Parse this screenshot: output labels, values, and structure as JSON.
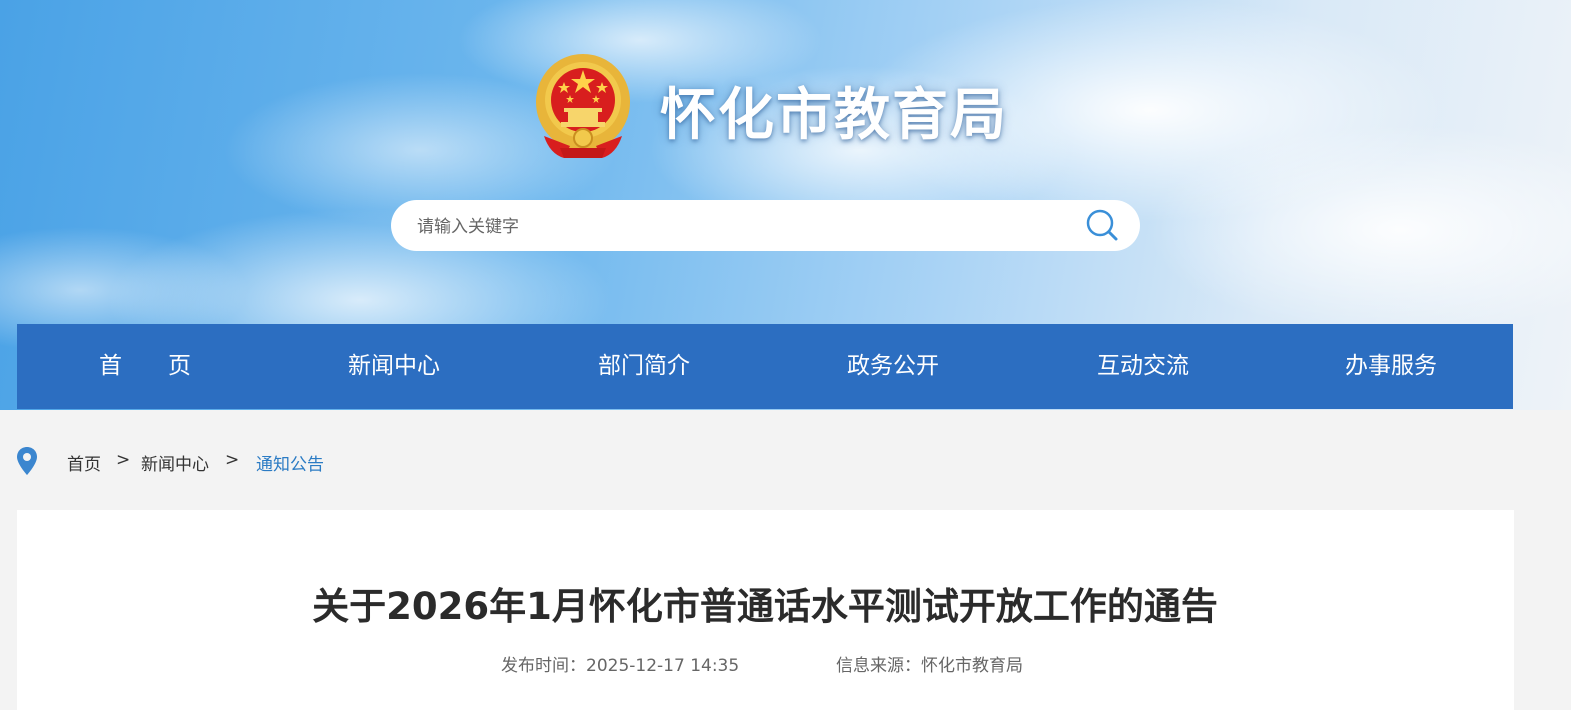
{
  "header": {
    "site_title": "怀化市教育局"
  },
  "search": {
    "placeholder": "请输入关键字"
  },
  "nav": {
    "items": [
      {
        "label": "首　　页"
      },
      {
        "label": "新闻中心"
      },
      {
        "label": "部门简介"
      },
      {
        "label": "政务公开"
      },
      {
        "label": "互动交流"
      },
      {
        "label": "办事服务"
      }
    ]
  },
  "breadcrumb": {
    "items": [
      {
        "label": "首页"
      },
      {
        "label": "新闻中心"
      },
      {
        "label": "通知公告"
      }
    ],
    "separator": ">"
  },
  "article": {
    "title": "关于2026年1月怀化市普通话水平测试开放工作的通告",
    "publish_time_label": "发布时间：2025-12-17 14:35",
    "source_label": "信息来源：怀化市教育局"
  },
  "colors": {
    "nav_background": "#2c6ec1",
    "breadcrumb_active": "#2b7bc4",
    "page_background": "#f3f3f3"
  },
  "icons": [
    "national-emblem-icon",
    "search-icon",
    "location-pin-icon"
  ]
}
